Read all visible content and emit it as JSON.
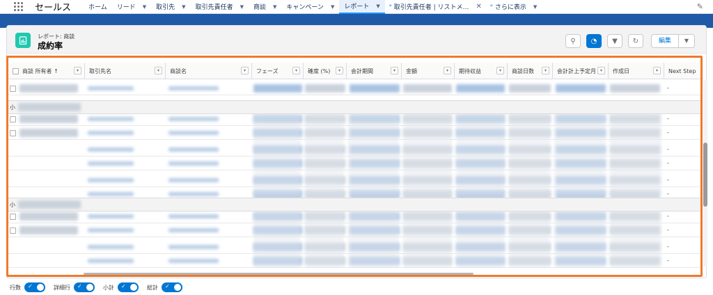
{
  "nav": {
    "app_name": "セールス",
    "items": [
      {
        "label": "ホーム",
        "has_dropdown": false
      },
      {
        "label": "リード",
        "has_dropdown": true
      },
      {
        "label": "取引先",
        "has_dropdown": true
      },
      {
        "label": "取引先責任者",
        "has_dropdown": true
      },
      {
        "label": "商談",
        "has_dropdown": true
      },
      {
        "label": "キャンペーン",
        "has_dropdown": true
      },
      {
        "label": "レポート",
        "has_dropdown": true,
        "active": true
      }
    ],
    "open_tab": "取引先責任者 | リストメ…",
    "more_label": "さらに表示"
  },
  "header": {
    "breadcrumb": "レポート: 商談",
    "title": "成約率",
    "edit_label": "編集"
  },
  "table": {
    "columns": [
      {
        "label": "商談 所有者 ↑"
      },
      {
        "label": "取引先名"
      },
      {
        "label": "商談名"
      },
      {
        "label": "フェーズ"
      },
      {
        "label": "確度 (%)"
      },
      {
        "label": "会計期間"
      },
      {
        "label": "金額"
      },
      {
        "label": "期待収益"
      },
      {
        "label": "商談日数"
      },
      {
        "label": "会計計上予定月"
      },
      {
        "label": "作成日"
      },
      {
        "label": "Next Step"
      }
    ],
    "subtotal_label_1": "小",
    "subtotal_label_2": "小",
    "dash": "-"
  },
  "footer": {
    "toggles": [
      {
        "label": "行数",
        "on": true
      },
      {
        "label": "詳細行",
        "on": true
      },
      {
        "label": "小計",
        "on": true
      },
      {
        "label": "総計",
        "on": true
      }
    ]
  },
  "colors": {
    "accent": "#0176d3",
    "highlight": "#ef7a2b",
    "band": "#1e5aa8",
    "report_icon": "#20c8b0"
  }
}
